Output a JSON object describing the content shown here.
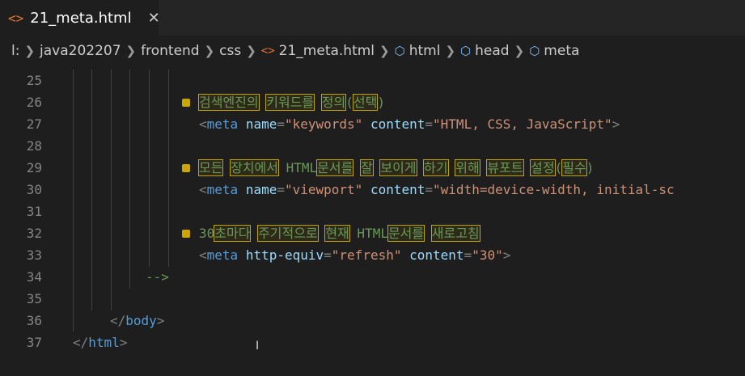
{
  "tab": {
    "icon": "<>",
    "title": "21_meta.html",
    "close": "✕"
  },
  "breadcrumb": {
    "drive": "l:",
    "parts": [
      "java202207",
      "frontend",
      "css"
    ],
    "file_icon": "<>",
    "file": "21_meta.html",
    "symbols": [
      "html",
      "head",
      "meta"
    ]
  },
  "lines": {
    "n25": "25",
    "n26": "26",
    "n27": "27",
    "n28": "28",
    "n29": "29",
    "n30": "30",
    "n31": "31",
    "n32": "32",
    "n33": "33",
    "n34": "34",
    "n35": "35",
    "n36": "36",
    "n37": "37"
  },
  "code": {
    "l26_words": [
      "검색엔진의",
      "키워드를",
      "정의",
      "(",
      "선택",
      ")"
    ],
    "l27": {
      "attr1": "name",
      "val1": "\"keywords\"",
      "attr2": "content",
      "val2": "\"HTML, CSS, JavaScript\""
    },
    "l29_words": [
      "모든",
      "장치에서",
      "HTML",
      "문서를",
      "잘",
      "보이게",
      "하기",
      "위해",
      "뷰포트",
      "설정",
      "(",
      "필수",
      ")"
    ],
    "l30": {
      "attr1": "name",
      "val1": "\"viewport\"",
      "attr2": "content",
      "val2": "\"width=device-width, initial-sc"
    },
    "l32_words": [
      "30",
      "초마다",
      "주기적으로",
      "현재",
      "HTML",
      "문서를",
      "새로고침"
    ],
    "l33": {
      "attr1": "http-equiv",
      "val1": "\"refresh\"",
      "attr2": "content",
      "val2": "\"30\""
    },
    "l34": "-->",
    "tag_meta": "meta",
    "tag_body": "body",
    "tag_html": "html"
  },
  "cursor": "I"
}
